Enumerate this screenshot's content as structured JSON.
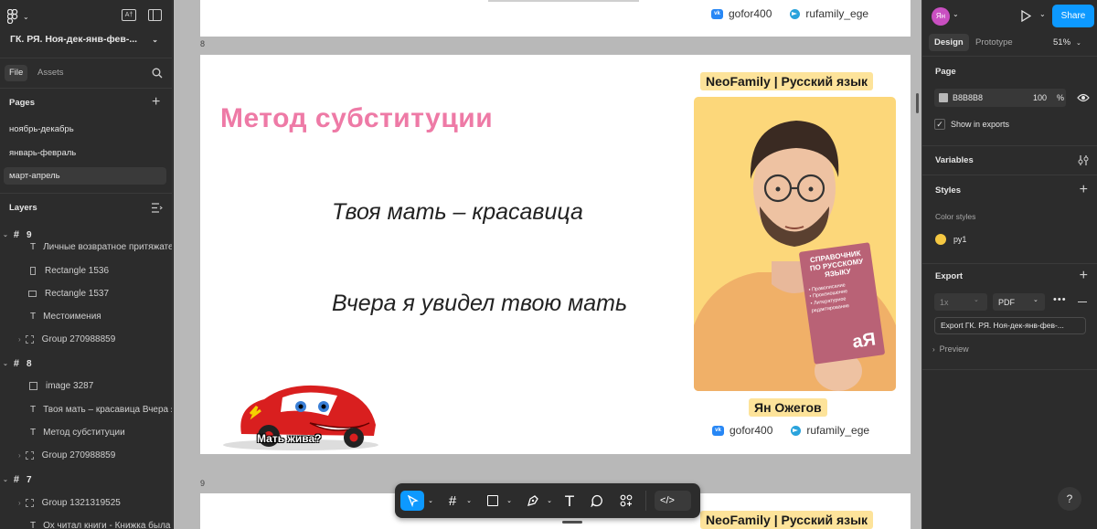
{
  "left_panel": {
    "file_name": "ГК. РЯ. Ноя-дек-янв-фев-...",
    "font_badge": "A†",
    "tabs": {
      "file": "File",
      "assets": "Assets"
    },
    "pages_title": "Pages",
    "pages": [
      "ноябрь-декабрь",
      "январь-февраль",
      "март-апрель"
    ],
    "layers_title": "Layers",
    "layers": {
      "frame_9": "9",
      "l1": "Личные возвратное притяжател",
      "l2": "Rectangle 1536",
      "l3": "Rectangle 1537",
      "l4": "Местоимения",
      "l5": "Group 270988859",
      "frame_8": "8",
      "l6": "image 3287",
      "l7": "Твоя мать – красавица Вчера я у",
      "l8": "Метод субституции",
      "l9": "Group 270988859",
      "frame_7": "7",
      "l10": "Group 1321319525",
      "l11": "Ох читал книги - Книжка была ин"
    }
  },
  "canvas": {
    "frame_label_8": "8",
    "frame_label_9": "9",
    "top_social": {
      "vk": "gofor400",
      "tg": "rufamily_ege"
    },
    "slide": {
      "brand_tag": "NeoFamily | Русский язык",
      "title": "Метод субституции",
      "sentence1": "Твоя мать – красавица",
      "sentence2": "Вчера я увидел твою мать",
      "name_tag": "Ян Ожегов",
      "social": {
        "vk": "gofor400",
        "tg": "rufamily_ege"
      },
      "meme_caption": "Мать жива?",
      "book_title": "СПРАВОЧНИК ПО РУССКОМУ ЯЗЫКУ",
      "book_items": [
        "• Правописание",
        "• Произношение",
        "• Литературное редактирование"
      ],
      "book_logo": "аЯ"
    },
    "next_brand_tag": "NeoFamily | Русский язык"
  },
  "toolbar": {
    "code_label": "</>"
  },
  "right_panel": {
    "avatar": "Ян",
    "share": "Share",
    "tabs": {
      "design": "Design",
      "prototype": "Prototype"
    },
    "zoom": "51%",
    "page_title": "Page",
    "page_color_hex": "B8B8B8",
    "page_opacity": "100",
    "page_pct": "%",
    "show_in_exports": "Show in exports",
    "variables_title": "Variables",
    "styles_title": "Styles",
    "color_styles": "Color styles",
    "style_name": "ру1",
    "export_title": "Export",
    "export_scale": "1x",
    "export_format": "PDF",
    "export_button": "Export ГК. РЯ. Ноя-дек-янв-фев-...",
    "preview": "Preview",
    "help": "?"
  },
  "colors": {
    "accent": "#0d99ff",
    "canvas_bg": "#b8b8b8",
    "title_pink": "#ee7aa6",
    "tag_yellow": "#fde39a",
    "photo_yellow": "#fcd77a",
    "style_swatch": "#f5c842"
  }
}
